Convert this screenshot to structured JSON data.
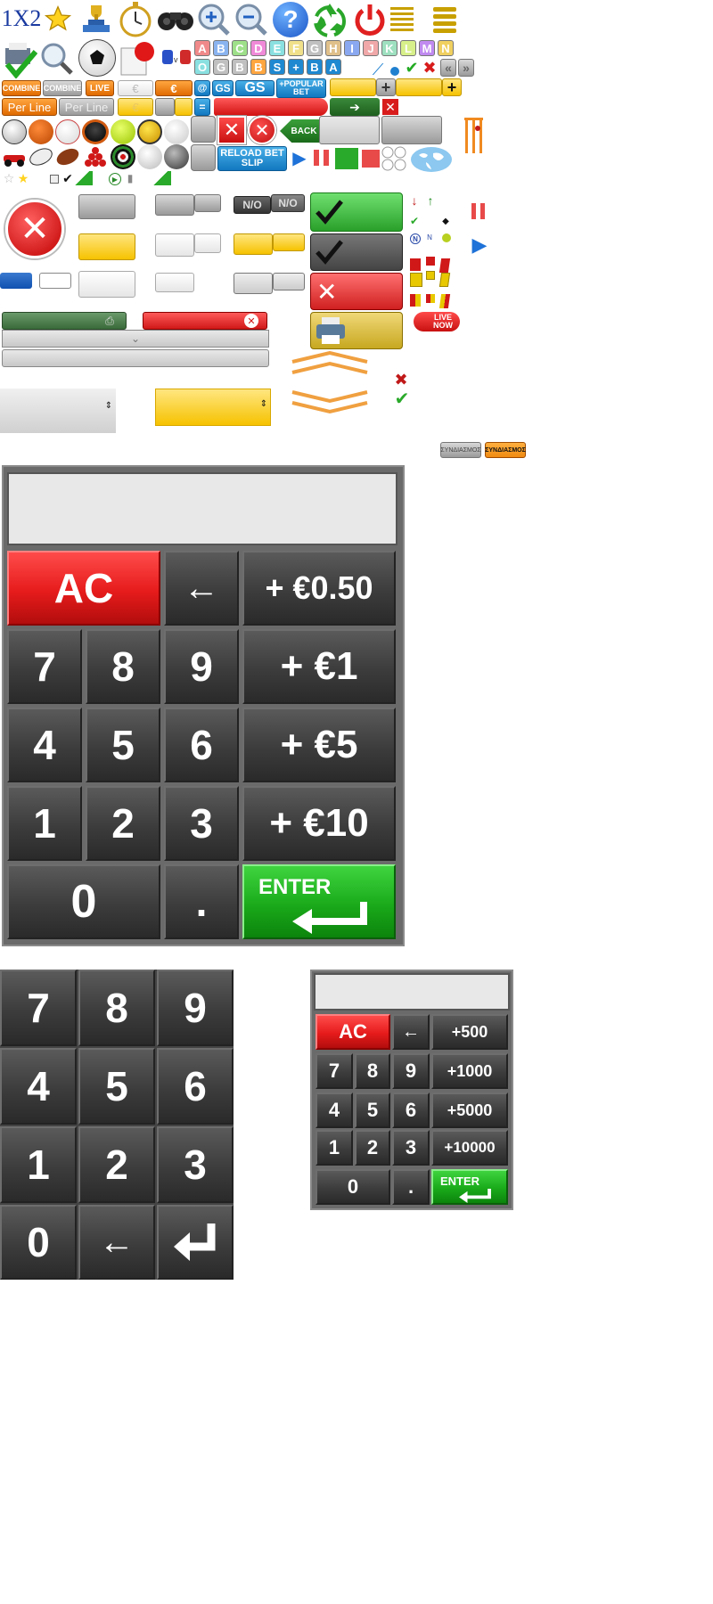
{
  "sprites": {
    "odds_label": "1X2",
    "combine_label": "COMBINE",
    "combine_label_alt": "COMBINE",
    "live_label": "LIVE",
    "per_line_label": "Per Line",
    "per_line_label_alt": "Per Line",
    "euro_symbol": "€",
    "euro_symbol_alt": "€",
    "at_label": "@",
    "gs_small_label": "GS",
    "gs_large_label": "GS",
    "popular_bet_label": "+POPULAR BET",
    "equals_label": "=",
    "back_label": "BACK",
    "reload_bet_slip_label": "RELOAD BET SLIP",
    "no_label": "N/O",
    "no_label_alt": "N/O",
    "live_now_label": "LIVE NOW",
    "combo_greek_label": "ΣΥΝΔΙΑΣΜΟΣ",
    "combo_greek_label_alt": "ΣΥΝΔΙΑΣΜΟΣ",
    "letters_row1": [
      "A",
      "B",
      "C",
      "D",
      "E",
      "F",
      "G",
      "H",
      "I",
      "J",
      "K",
      "L",
      "M",
      "N"
    ],
    "letters_row1_colors": [
      "#f08a8a",
      "#8ab4f0",
      "#9ee08a",
      "#f08ad8",
      "#8ae0e0",
      "#f0e08a",
      "#c0c0c0",
      "#e0c08a",
      "#8aa8f0",
      "#f0a8a8",
      "#9ee0c0",
      "#d8f08a",
      "#c08af0",
      "#f0d060"
    ],
    "letters_row2": [
      "O",
      "G",
      "B",
      "B",
      "S",
      "+",
      "B",
      "A"
    ],
    "letters_row2_colors": [
      "#8ae0e0",
      "#c0c0c0",
      "#c0c0c0",
      "#ffa640",
      "#1e88d0",
      "#1e88d0",
      "#1e88d0",
      "#1e88d0"
    ],
    "icons": [
      "trophy-icon",
      "star-icon",
      "stopwatch-icon",
      "binoculars-icon",
      "zoom-in-icon",
      "zoom-out-icon",
      "help-icon",
      "recycle-icon",
      "power-icon",
      "list-icon",
      "printer-icon",
      "checkmark-icon",
      "search-icon",
      "football-icon",
      "whistle-icon",
      "basketball-icon",
      "baseball-icon",
      "hockey-icon",
      "tennis-icon",
      "volleyball-icon",
      "golf-icon",
      "rugby-icon",
      "american-football-icon",
      "snooker-icon",
      "darts-icon",
      "globe-icon",
      "cricket-icon",
      "close-icon",
      "play-icon",
      "pause-icon"
    ]
  },
  "calculator_large": {
    "display_value": "",
    "keys": {
      "ac": "AC",
      "back": "←",
      "add_050": "+ €0.50",
      "seven": "7",
      "eight": "8",
      "nine": "9",
      "add_1": "+ €1",
      "four": "4",
      "five": "5",
      "six": "6",
      "add_5": "+ €5",
      "one": "1",
      "two": "2",
      "three": "3",
      "add_10": "+ €10",
      "zero": "0",
      "dot": ".",
      "enter": "ENTER"
    }
  },
  "numpad": {
    "keys": {
      "seven": "7",
      "eight": "8",
      "nine": "9",
      "four": "4",
      "five": "5",
      "six": "6",
      "one": "1",
      "two": "2",
      "three": "3",
      "zero": "0",
      "back": "←"
    }
  },
  "calculator_small": {
    "display_value": "",
    "keys": {
      "ac": "AC",
      "back": "←",
      "add_500": "+500",
      "seven": "7",
      "eight": "8",
      "nine": "9",
      "add_1000": "+1000",
      "four": "4",
      "five": "5",
      "six": "6",
      "add_5000": "+5000",
      "one": "1",
      "two": "2",
      "three": "3",
      "add_10000": "+10000",
      "zero": "0",
      "dot": ".",
      "enter": "ENTER"
    }
  },
  "colors": {
    "key_dark": "#3c3c3c",
    "key_red": "#e61b1b",
    "key_green": "#1aaa1a",
    "display_bg": "#e8e8e8",
    "accent_yellow": "#f6c200",
    "accent_orange": "#f08a20"
  }
}
